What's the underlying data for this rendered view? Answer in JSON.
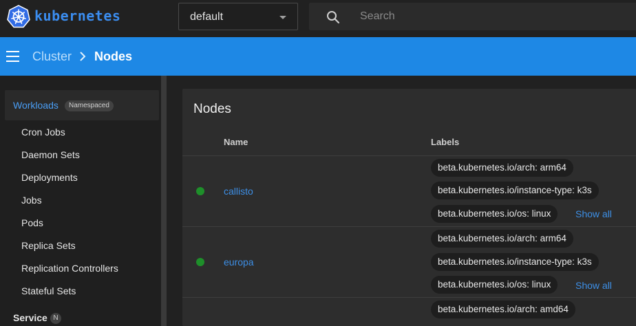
{
  "brand": {
    "name": "kubernetes",
    "color": "#3b8df0"
  },
  "namespace_select": {
    "value": "default"
  },
  "search": {
    "placeholder": "Search"
  },
  "breadcrumb": {
    "parent": "Cluster",
    "current": "Nodes"
  },
  "colors": {
    "appbar": "#1e88e5",
    "link": "#3d8fe6",
    "status_ready": "#1e8f2a"
  },
  "sidebar": {
    "workloads": {
      "label": "Workloads",
      "badge": "Namespaced",
      "items": [
        "Cron Jobs",
        "Daemon Sets",
        "Deployments",
        "Jobs",
        "Pods",
        "Replica Sets",
        "Replication Controllers",
        "Stateful Sets"
      ]
    },
    "service": {
      "label": "Service",
      "badge": "N"
    }
  },
  "panel": {
    "title": "Nodes",
    "columns": {
      "name": "Name",
      "labels": "Labels"
    },
    "rows": [
      {
        "name": "callisto",
        "labels": [
          "beta.kubernetes.io/arch: arm64",
          "beta.kubernetes.io/instance-type: k3s",
          "beta.kubernetes.io/os: linux"
        ],
        "show_all": "Show all"
      },
      {
        "name": "europa",
        "labels": [
          "beta.kubernetes.io/arch: arm64",
          "beta.kubernetes.io/instance-type: k3s",
          "beta.kubernetes.io/os: linux"
        ],
        "show_all": "Show all"
      },
      {
        "labels": [
          "beta.kubernetes.io/arch: amd64"
        ]
      }
    ]
  }
}
